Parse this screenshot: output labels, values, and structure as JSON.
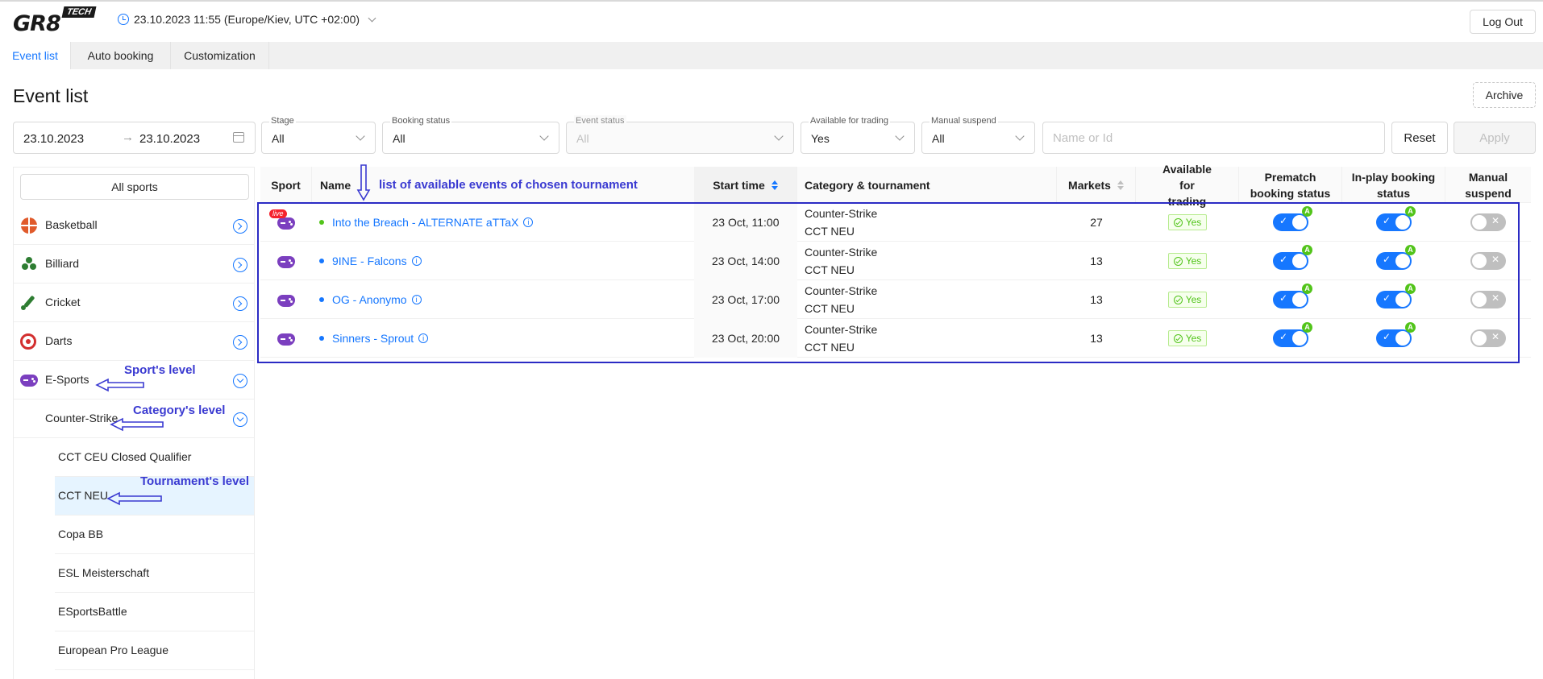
{
  "header": {
    "logo_text": "GR8",
    "logo_badge": "TECH",
    "datetime": "23.10.2023 11:55 (Europe/Kiev, UTC +02:00)",
    "logout_label": "Log Out"
  },
  "tabs": [
    {
      "label": "Event list",
      "active": true
    },
    {
      "label": "Auto booking",
      "active": false
    },
    {
      "label": "Customization",
      "active": false
    }
  ],
  "page": {
    "title": "Event list",
    "archive_label": "Archive"
  },
  "filters": {
    "date_from": "23.10.2023",
    "date_arrow": "→",
    "date_to": "23.10.2023",
    "stage": {
      "label": "Stage",
      "value": "All"
    },
    "booking_status": {
      "label": "Booking status",
      "value": "All"
    },
    "event_status": {
      "label": "Event status",
      "value": "All"
    },
    "available_for_trading": {
      "label": "Available for trading",
      "value": "Yes"
    },
    "manual_suspend": {
      "label": "Manual suspend",
      "value": "All"
    },
    "search_placeholder": "Name or Id",
    "reset_label": "Reset",
    "apply_label": "Apply"
  },
  "sidebar": {
    "all_sports_label": "All sports",
    "sports": [
      {
        "label": "Basketball",
        "icon": "basketball-icon"
      },
      {
        "label": "Billiard",
        "icon": "billiard-icon"
      },
      {
        "label": "Cricket",
        "icon": "cricket-icon"
      },
      {
        "label": "Darts",
        "icon": "darts-icon"
      },
      {
        "label": "E-Sports",
        "icon": "gamepad-icon",
        "expanded": true
      }
    ],
    "category": {
      "label": "Counter-Strike",
      "expanded": true
    },
    "tournaments": [
      {
        "label": "CCT CEU Closed Qualifier",
        "selected": false
      },
      {
        "label": "CCT NEU",
        "selected": true
      },
      {
        "label": "Copa BB",
        "selected": false
      },
      {
        "label": "ESL Meisterschaft",
        "selected": false
      },
      {
        "label": "ESportsBattle",
        "selected": false
      },
      {
        "label": "European Pro League",
        "selected": false
      }
    ]
  },
  "table": {
    "columns": {
      "sport": "Sport",
      "name": "Name",
      "start_time": "Start time",
      "category": "Category & tournament",
      "markets": "Markets",
      "available": "Available for trading",
      "prematch": "Prematch booking status",
      "inplay": "In-play booking status",
      "suspend": "Manual suspend"
    },
    "rows": [
      {
        "live": "live",
        "name": "Into the Breach - ALTERNATE aTTaX",
        "status_color": "#52c41a",
        "start": "23 Oct, 11:00",
        "category": "Counter-Strike",
        "tournament": "CCT NEU",
        "markets": "27",
        "available": "Yes",
        "prematch": true,
        "inplay": true,
        "suspend": false
      },
      {
        "live": "",
        "name": "9INE - Falcons",
        "status_color": "#1677ff",
        "start": "23 Oct, 14:00",
        "category": "Counter-Strike",
        "tournament": "CCT NEU",
        "markets": "13",
        "available": "Yes",
        "prematch": true,
        "inplay": true,
        "suspend": false
      },
      {
        "live": "",
        "name": "OG - Anonymo",
        "status_color": "#1677ff",
        "start": "23 Oct, 17:00",
        "category": "Counter-Strike",
        "tournament": "CCT NEU",
        "markets": "13",
        "available": "Yes",
        "prematch": true,
        "inplay": true,
        "suspend": false
      },
      {
        "live": "",
        "name": "Sinners - Sprout",
        "status_color": "#1677ff",
        "start": "23 Oct, 20:00",
        "category": "Counter-Strike",
        "tournament": "CCT NEU",
        "markets": "13",
        "available": "Yes",
        "prematch": true,
        "inplay": true,
        "suspend": false
      }
    ],
    "switch_on_mark": "✓",
    "switch_off_mark": "✕",
    "auto_badge": "A"
  },
  "annotations": {
    "list_note": "list of available events of chosen tournament",
    "sport_level": "Sport's level",
    "category_level": "Category's level",
    "tournament_level": "Tournament's level"
  },
  "colors": {
    "accent": "#1677ff",
    "annotation": "#3a3ad1",
    "live": "#f5222d",
    "success": "#52c41a"
  }
}
